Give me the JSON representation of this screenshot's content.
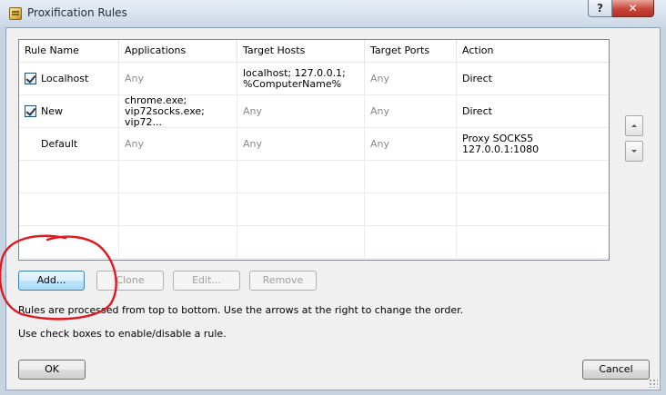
{
  "window": {
    "title": "Proxification Rules",
    "help_label": "?",
    "close_label": "✕"
  },
  "table": {
    "columns": [
      "Rule Name",
      "Applications",
      "Target Hosts",
      "Target Ports",
      "Action"
    ],
    "rows": [
      {
        "name": "Localhost",
        "enabled": true,
        "applications": "Any",
        "target_hosts": "localhost; 127.0.0.1;\n%ComputerName%",
        "target_ports": "Any",
        "action": "Direct"
      },
      {
        "name": "New",
        "enabled": true,
        "applications": "chrome.exe;\nvip72socks.exe; vip72...",
        "target_hosts": "Any",
        "target_ports": "Any",
        "action": "Direct"
      },
      {
        "name": "Default",
        "enabled": null,
        "applications": "Any",
        "target_hosts": "Any",
        "target_ports": "Any",
        "action": "Proxy SOCKS5\n127.0.0.1:1080"
      }
    ]
  },
  "order_buttons": {
    "up_icon": "arrow-up-icon",
    "down_icon": "arrow-down-icon"
  },
  "buttons": {
    "add": "Add...",
    "clone": "Clone",
    "edit": "Edit...",
    "remove": "Remove",
    "ok": "OK",
    "cancel": "Cancel"
  },
  "notes": {
    "order": "Rules are processed from top to bottom. Use the arrows at the right to change the order.",
    "checkbox": "Use check boxes to enable/disable a rule."
  },
  "colors": {
    "annotation": "#e0191f",
    "titlebar": "#cbd7e6",
    "close_button": "#c8453a"
  }
}
